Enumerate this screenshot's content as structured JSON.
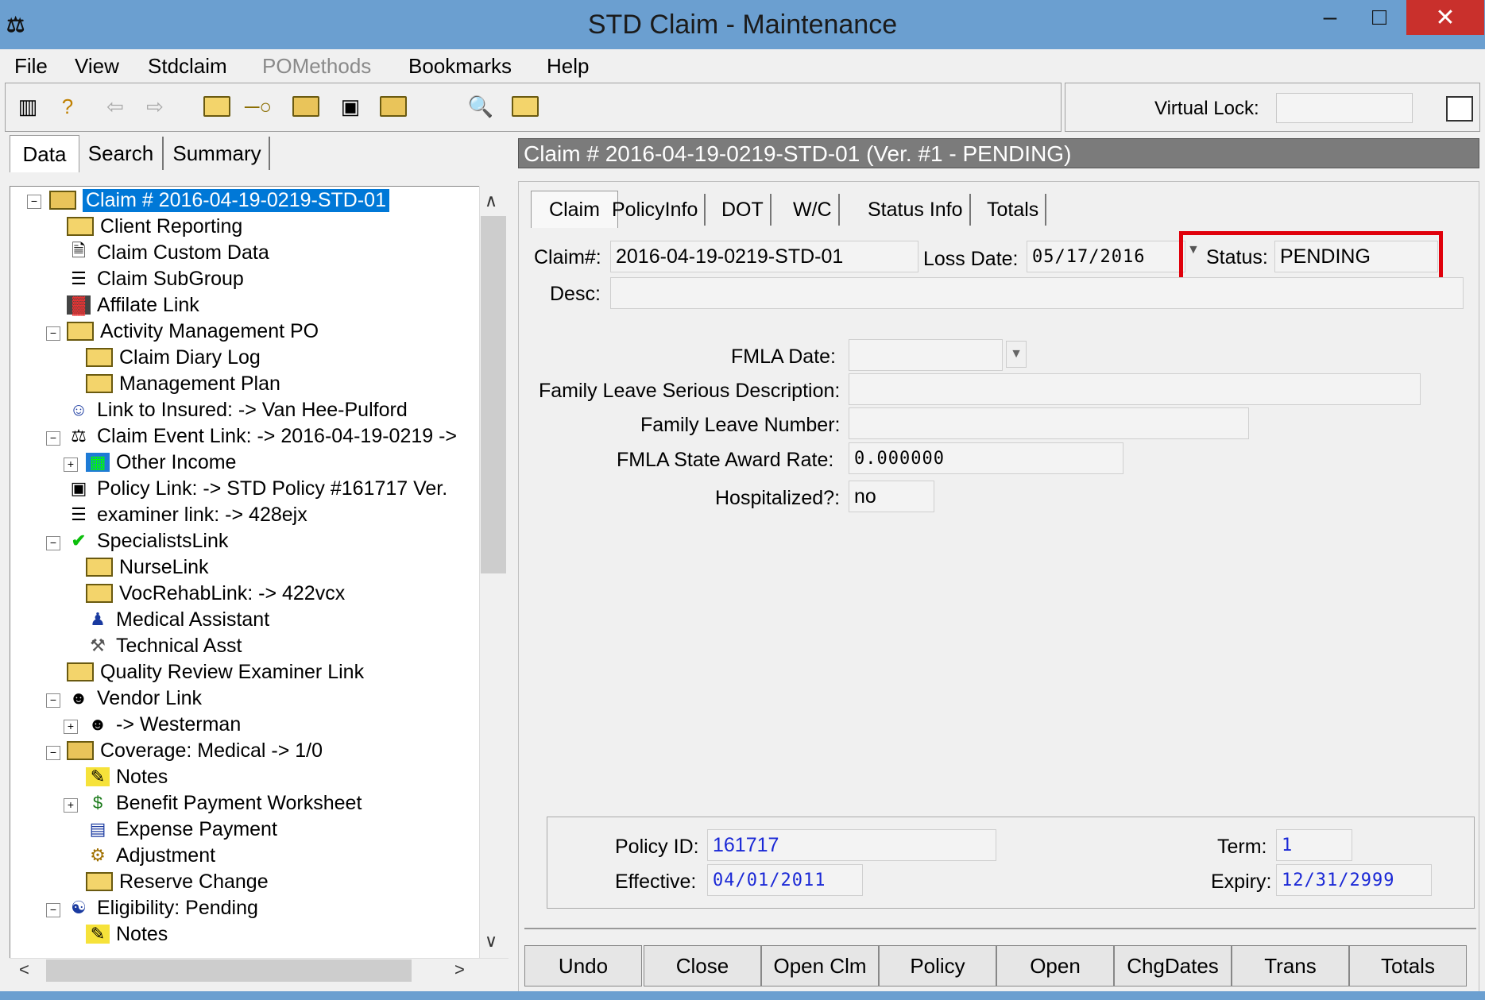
{
  "window": {
    "title": "STD Claim - Maintenance",
    "min": "–",
    "max": "□",
    "close": "✕",
    "app_icon": "⚖"
  },
  "menu": [
    "File",
    "View",
    "Stdclaim",
    "POMethods",
    "Bookmarks",
    "Help"
  ],
  "toolbar": {
    "icons": [
      "exit-icon",
      "help-icon",
      "back-icon",
      "forward-icon",
      "folder-icon",
      "key-icon",
      "open-folder-icon",
      "policy-icon",
      "open-folder-icon",
      "preview-icon",
      "folder-icon"
    ],
    "virtual_lock_label": "Virtual Lock:",
    "virtual_lock_value": ""
  },
  "left_tabs": [
    "Data",
    "Search",
    "Summary"
  ],
  "header": "Claim # 2016-04-19-0219-STD-01 (Ver. #1 - PENDING)",
  "tree": [
    {
      "label": "Claim # 2016-04-19-0219-STD-01",
      "icon": "open-folder-icon",
      "selected": true
    },
    {
      "label": "Client Reporting",
      "icon": "folder-icon"
    },
    {
      "label": "Claim Custom Data",
      "icon": "document-icon"
    },
    {
      "label": "Claim SubGroup",
      "icon": "list-icon"
    },
    {
      "label": "Affilate Link",
      "icon": "chart-icon"
    },
    {
      "label": "Activity Management PO",
      "icon": "folder-icon"
    },
    {
      "label": "Claim Diary Log",
      "icon": "folder-icon"
    },
    {
      "label": "Management Plan",
      "icon": "folder-icon"
    },
    {
      "label": "Link to Insured:  -> Van Hee-Pulford",
      "icon": "person-icon"
    },
    {
      "label": "Claim Event Link:  -> 2016-04-19-0219 ->",
      "icon": "scales-icon"
    },
    {
      "label": "Other Income",
      "icon": "grid-icon"
    },
    {
      "label": "Policy Link:  -> STD Policy #161717 Ver.",
      "icon": "policy-icon"
    },
    {
      "label": "examiner link:  -> 428ejx",
      "icon": "list-icon"
    },
    {
      "label": "SpecialistsLink",
      "icon": "check-icon"
    },
    {
      "label": "NurseLink",
      "icon": "folder-icon"
    },
    {
      "label": "VocRehabLink:  -> 422vcx",
      "icon": "folder-icon"
    },
    {
      "label": "Medical Assistant",
      "icon": "people-icon"
    },
    {
      "label": "Technical Asst",
      "icon": "wrench-icon"
    },
    {
      "label": "Quality Review Examiner Link",
      "icon": "folder-icon"
    },
    {
      "label": "Vendor Link",
      "icon": "vendor-icon"
    },
    {
      "label": " -> Westerman",
      "icon": "vendor-icon"
    },
    {
      "label": "Coverage: Medical -> 1/0",
      "icon": "open-folder-icon"
    },
    {
      "label": "Notes",
      "icon": "notes-icon"
    },
    {
      "label": "Benefit Payment Worksheet",
      "icon": "payment-icon"
    },
    {
      "label": "Expense Payment",
      "icon": "expense-icon"
    },
    {
      "label": "Adjustment",
      "icon": "adjust-icon"
    },
    {
      "label": "Reserve Change",
      "icon": "folder-icon"
    },
    {
      "label": "Eligibility: Pending",
      "icon": "eligibility-icon"
    },
    {
      "label": "Notes",
      "icon": "notes-icon"
    }
  ],
  "right_tabs": [
    "Claim",
    "PolicyInfo",
    "DOT",
    "W/C",
    "Status Info",
    "Totals"
  ],
  "claim": {
    "claim_no_label": "Claim#:",
    "claim_no": "2016-04-19-0219-STD-01",
    "loss_date_label": "Loss Date:",
    "loss_date": "05/17/2016",
    "status_label": "Status:",
    "status": "PENDING",
    "desc_label": "Desc:",
    "desc": "",
    "fmla_date_label": "FMLA Date:",
    "fmla_date": "",
    "fl_serious_label": "Family Leave Serious Description:",
    "fl_serious": "",
    "fl_number_label": "Family Leave Number:",
    "fl_number": "",
    "fmla_rate_label": "FMLA State Award Rate:",
    "fmla_rate": "0.000000",
    "hosp_label": "Hospitalized?:",
    "hosp": "no"
  },
  "policy": {
    "policy_id_label": "Policy ID:",
    "policy_id": "161717",
    "effective_label": "Effective:",
    "effective": "04/01/2011",
    "term_label": "Term:",
    "term": "1",
    "expiry_label": "Expiry:",
    "expiry": "12/31/2999"
  },
  "buttons": [
    "Undo",
    "Close",
    "Open Clm",
    "Policy",
    "Open",
    "ChgDates",
    "Trans",
    "Totals"
  ]
}
